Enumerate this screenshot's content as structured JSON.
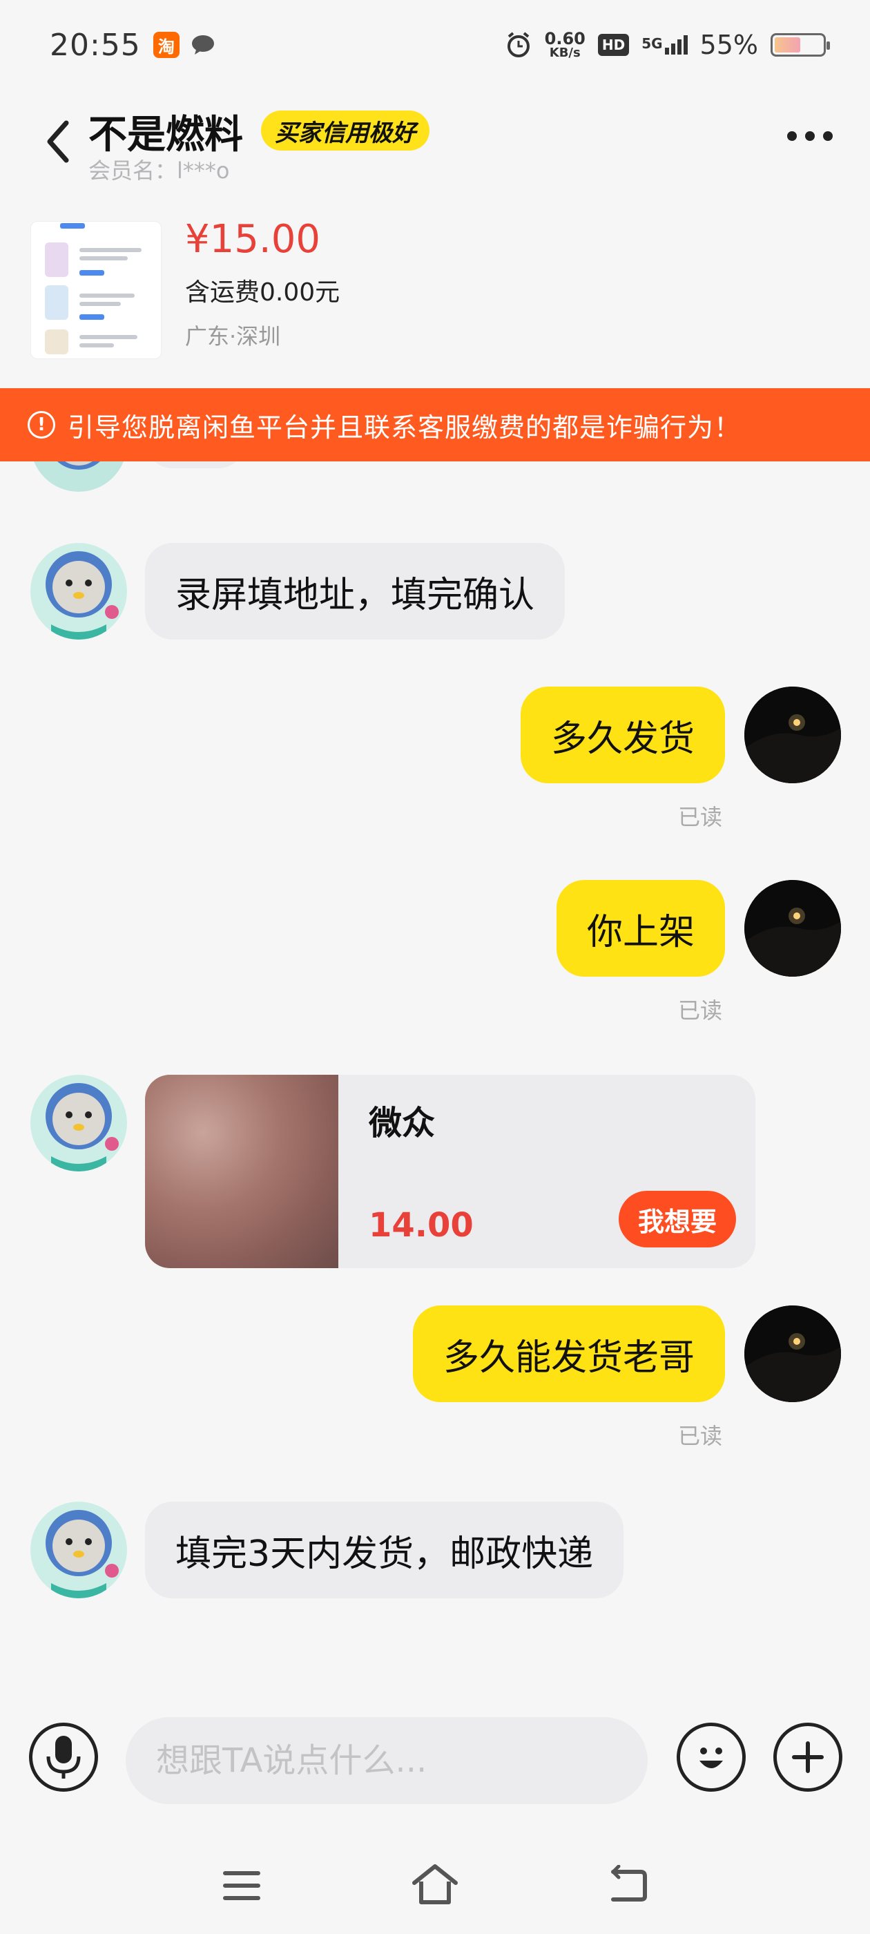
{
  "status_bar": {
    "time": "20:55",
    "taobao_label": "淘",
    "net_speed_value": "0.60",
    "net_speed_unit": "KB/s",
    "hd_label": "HD",
    "signal_label": "5G",
    "battery_percent": "55%",
    "battery_level": 0.55
  },
  "header": {
    "seller_name": "不是燃料",
    "credit_badge": "买家信用极好",
    "member_name": "会员名：l***o"
  },
  "product": {
    "price": "¥15.00",
    "shipping": "含运费0.00元",
    "location": "广东·深圳"
  },
  "warning": {
    "icon": "!",
    "text": "引导您脱离闲鱼平台并且联系客服缴费的都是诈骗行为！"
  },
  "messages": [
    {
      "side": "in",
      "text": "录屏填地址，填完确认"
    },
    {
      "side": "out",
      "text": "多久发货",
      "status": "已读"
    },
    {
      "side": "out",
      "text": "你上架",
      "status": "已读"
    },
    {
      "side": "out",
      "text": "多久能发货老哥",
      "status": "已读"
    },
    {
      "side": "in",
      "text": "填完3天内发货，邮政快递"
    }
  ],
  "product_message": {
    "title": "微众",
    "price": "14.00",
    "button": "我想要"
  },
  "input": {
    "placeholder": "想跟TA说点什么..."
  },
  "icons": {
    "back": "back-arrow-icon",
    "more": "more-icon",
    "mic": "microphone-icon",
    "emoji": "emoji-icon",
    "plus": "plus-icon",
    "nav_menu": "menu-icon",
    "nav_home": "home-icon",
    "nav_back": "back-icon"
  },
  "colors": {
    "accent_yellow": "#ffe214",
    "price_red": "#e8413a",
    "warning_orange": "#ff5a1f"
  }
}
